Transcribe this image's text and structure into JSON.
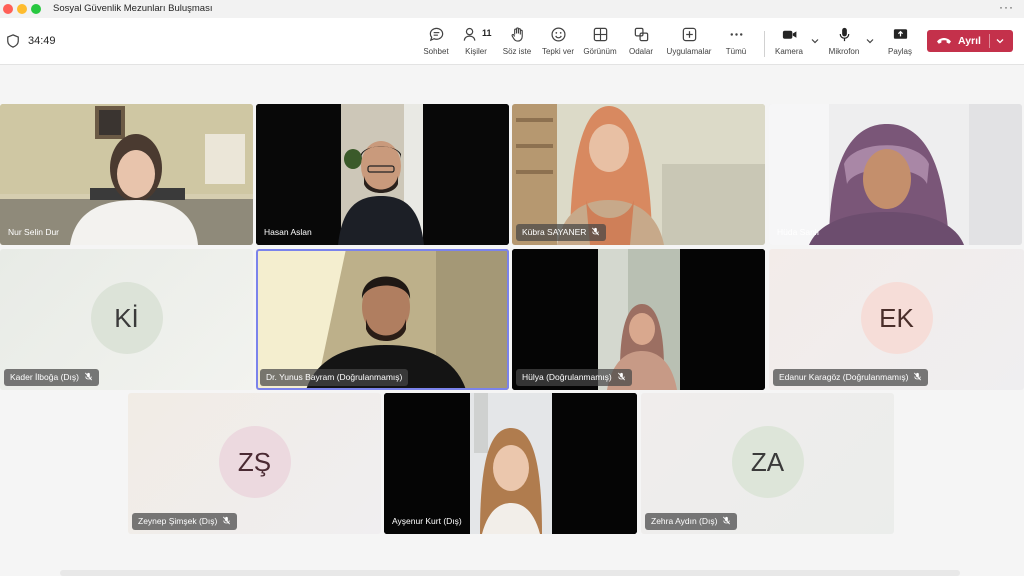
{
  "window": {
    "title": "Sosyal Güvenlik Mezunları Buluşması",
    "menu_icon": "more-horizontal-icon"
  },
  "toolbar": {
    "timer": "34:49",
    "chat_label": "Sohbet",
    "people_label": "Kişiler",
    "people_count": "11",
    "raise_label": "Söz iste",
    "react_label": "Tepki ver",
    "view_label": "Görünüm",
    "rooms_label": "Odalar",
    "apps_label": "Uygulamalar",
    "more_label": "Tümü",
    "camera_label": "Kamera",
    "mic_label": "Mikrofon",
    "share_label": "Paylaş",
    "leave_label": "Ayrıl"
  },
  "colors": {
    "leave": "#c4314b",
    "active_speaker": "#7b83eb"
  },
  "participants": [
    {
      "name": "Nur Selin Dur",
      "muted": false,
      "video": true
    },
    {
      "name": "Hasan Aslan",
      "muted": false,
      "video": true
    },
    {
      "name": "Kübra SAYANER",
      "muted": true,
      "video": true
    },
    {
      "name": "Hüda Sanlı",
      "muted": false,
      "video": true
    },
    {
      "name": "Kader İlboğa (Dış)",
      "initials": "Kİ",
      "muted": true,
      "video": false
    },
    {
      "name": "Dr. Yunus Bayram (Doğrulanmamış)",
      "muted": false,
      "video": true,
      "active": true
    },
    {
      "name": "Hülya (Doğrulanmamış)",
      "muted": true,
      "video": true
    },
    {
      "name": "Edanur Karagöz (Doğrulanmamış)",
      "initials": "EK",
      "muted": true,
      "video": false
    },
    {
      "name": "Zeynep Şimşek (Dış)",
      "initials": "ZŞ",
      "muted": true,
      "video": false
    },
    {
      "name": "Ayşenur Kurt (Dış)",
      "muted": false,
      "video": true
    },
    {
      "name": "Zehra Aydın (Dış)",
      "initials": "ZA",
      "muted": true,
      "video": false
    }
  ]
}
